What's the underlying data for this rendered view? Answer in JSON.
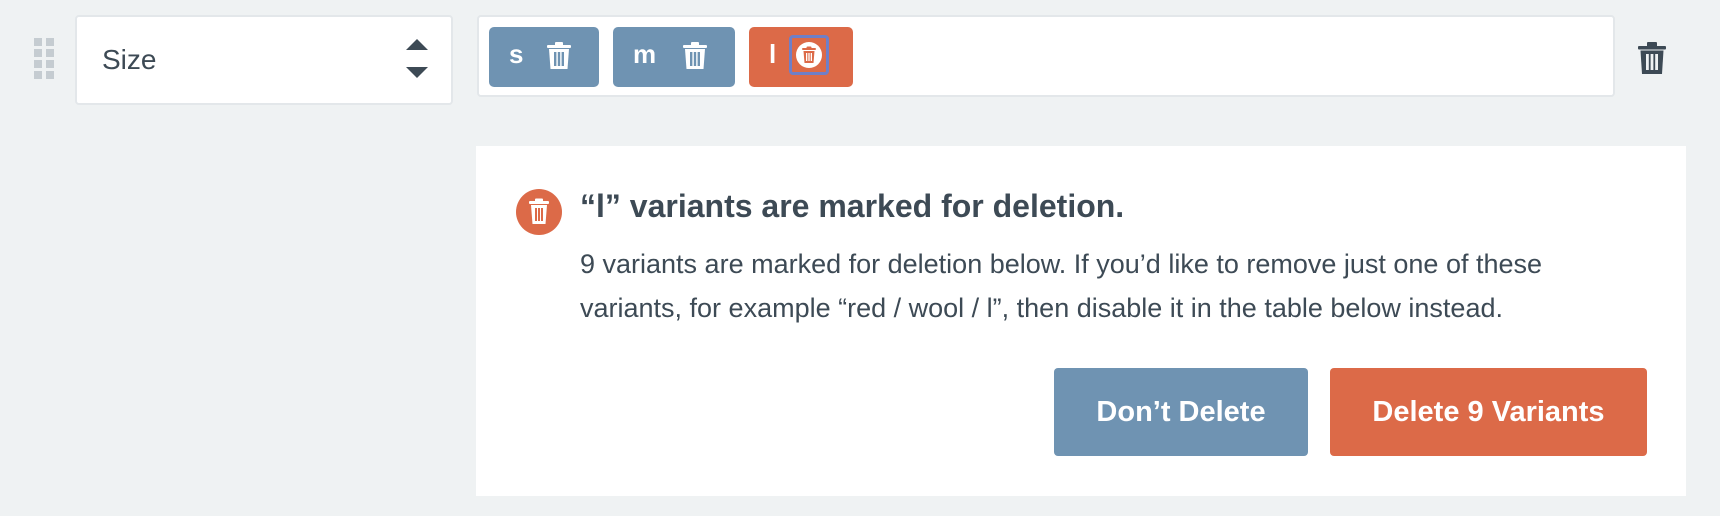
{
  "option_row": {
    "option_name": "Size",
    "values": [
      {
        "label": "s",
        "marked": false
      },
      {
        "label": "m",
        "marked": false
      },
      {
        "label": "l",
        "marked": true
      }
    ]
  },
  "deletion_notice": {
    "title": "“l” variants are marked for deletion.",
    "body": "9 variants are marked for deletion below. If you’d like to remove just one of these variants, for example “red / wool / l”, then disable it in the table below instead.",
    "cancel_label": "Don’t Delete",
    "confirm_label": "Delete 9 Variants"
  },
  "colors": {
    "accent_blue": "#6f93b2",
    "danger_orange": "#dc6a48",
    "background": "#eff2f3",
    "text": "#3d4a55"
  },
  "icons": [
    "drag-handle-icon",
    "sort-arrows-icon",
    "trash-icon"
  ]
}
